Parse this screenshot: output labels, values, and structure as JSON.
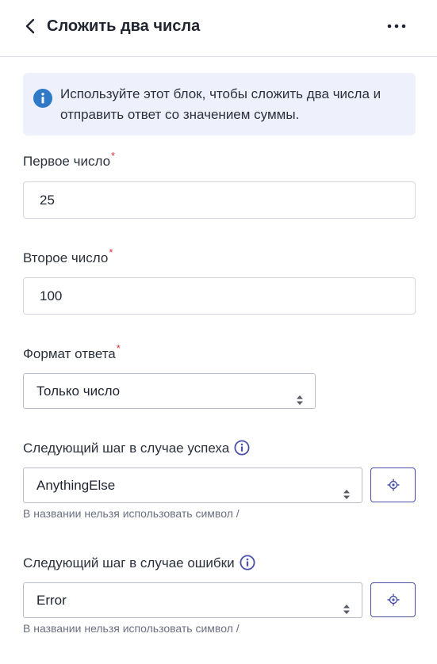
{
  "header": {
    "title": "Сложить два числа"
  },
  "info": {
    "text": "Используйте этот блок, чтобы сложить два числа и отправить ответ со значением суммы."
  },
  "fields": {
    "first": {
      "label": "Первое число",
      "required_mark": "*",
      "value": "25"
    },
    "second": {
      "label": "Второе число",
      "required_mark": "*",
      "value": "100"
    },
    "format": {
      "label": "Формат ответа",
      "required_mark": "*",
      "selected": "Только число"
    },
    "success": {
      "label": "Следующий шаг в случае успеха",
      "selected": "AnythingElse",
      "hint": "В названии нельзя использовать символ /"
    },
    "error": {
      "label": "Следующий шаг в случае ошибки",
      "selected": "Error",
      "hint": "В названии нельзя использовать символ /"
    }
  },
  "colors": {
    "accent": "#4a4fa8",
    "info_bg": "#eef1fb",
    "info_icon": "#2f79c6",
    "required": "#e0303a"
  },
  "icons": [
    "back-arrow-icon",
    "more-dots-icon",
    "info-icon",
    "help-info-icon",
    "select-arrows-icon",
    "target-icon"
  ]
}
